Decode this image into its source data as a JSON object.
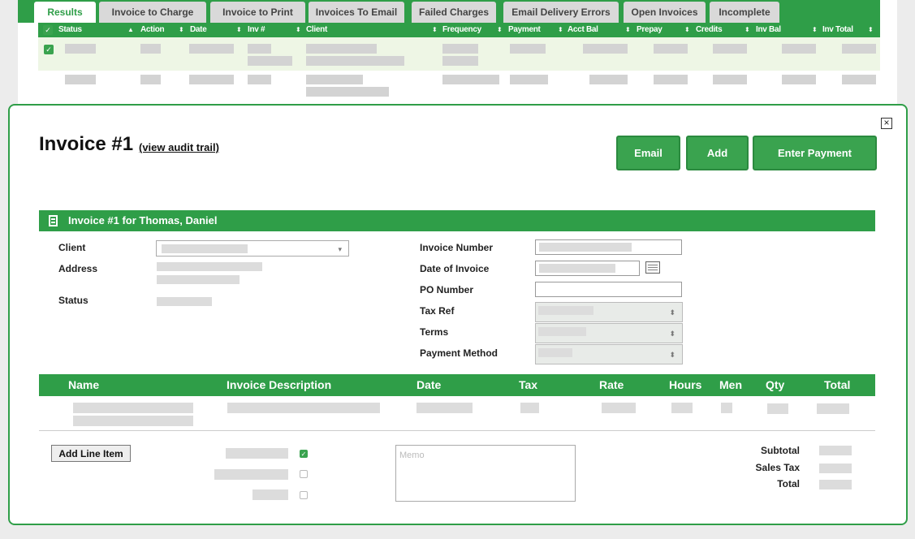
{
  "tabs": [
    "Results",
    "Invoice to Charge",
    "Invoice to Print",
    "Invoices To Email",
    "Failed Charges",
    "Email Delivery Errors",
    "Open Invoices",
    "Incomplete"
  ],
  "active_tab": "Results",
  "table": {
    "columns": [
      "Status",
      "Action",
      "Date",
      "Inv #",
      "Client",
      "Frequency",
      "Payment",
      "Acct Bal",
      "Prepay",
      "Credits",
      "Inv Bal",
      "Inv Total"
    ],
    "rows": [
      {
        "selected": true
      },
      {
        "selected": false
      }
    ]
  },
  "modal": {
    "title": "Invoice #1",
    "audit_link": "(view audit trail)",
    "buttons": {
      "email": "Email",
      "add": "Add",
      "enter_payment": "Enter Payment"
    },
    "close_symbol": "×",
    "section_title": "Invoice #1 for Thomas, Daniel",
    "fields_left": {
      "client": "Client",
      "address": "Address",
      "status": "Status"
    },
    "fields_right": {
      "invoice_number": "Invoice Number",
      "date_of_invoice": "Date of Invoice",
      "po_number": "PO Number",
      "tax_ref": "Tax Ref",
      "terms": "Terms",
      "payment_method": "Payment Method"
    },
    "line_columns": [
      "Name",
      "Invoice Description",
      "Date",
      "Tax",
      "Rate",
      "Hours",
      "Men",
      "Qty",
      "Total"
    ],
    "add_line_item": "Add Line Item",
    "memo_placeholder": "Memo",
    "totals": {
      "subtotal": "Subtotal",
      "sales_tax": "Sales Tax",
      "total": "Total"
    }
  },
  "colors": {
    "accent": "#2f9e48",
    "row_highlight": "#eef6e5",
    "placeholder_bar": "#d3d3d3"
  }
}
